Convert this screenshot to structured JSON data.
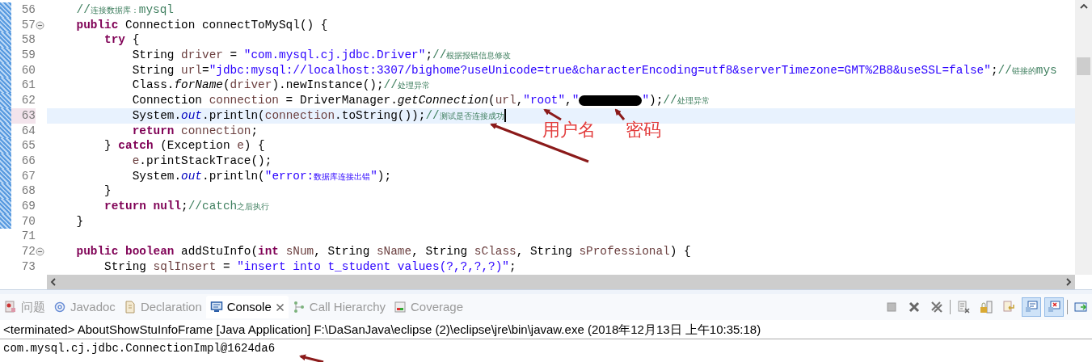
{
  "editor": {
    "lines": [
      {
        "number": "56",
        "fold": false,
        "current": false,
        "changed": true,
        "tokens": [
          {
            "text": "    //",
            "kind": "comment"
          },
          {
            "text": "连接数据库：",
            "kind": "comment_cjk"
          },
          {
            "text": "mysql",
            "kind": "comment"
          }
        ]
      },
      {
        "number": "57",
        "fold": true,
        "current": false,
        "changed": true,
        "tokens": [
          {
            "text": "    public",
            "kind": "kw"
          },
          {
            "text": " Connection connectToMySql() {",
            "kind": "plain"
          }
        ]
      },
      {
        "number": "58",
        "fold": false,
        "current": false,
        "changed": true,
        "tokens": [
          {
            "text": "        try",
            "kind": "kw"
          },
          {
            "text": " {",
            "kind": "plain"
          }
        ]
      },
      {
        "number": "59",
        "fold": false,
        "current": false,
        "changed": true,
        "tokens": [
          {
            "text": "            String ",
            "kind": "plain"
          },
          {
            "text": "driver",
            "kind": "local"
          },
          {
            "text": " = ",
            "kind": "plain"
          },
          {
            "text": "\"com.mysql.cj.jdbc.Driver\"",
            "kind": "str"
          },
          {
            "text": ";",
            "kind": "plain"
          },
          {
            "text": "//",
            "kind": "comment"
          },
          {
            "text": "根据报错信息修改",
            "kind": "comment_cjk"
          }
        ]
      },
      {
        "number": "60",
        "fold": false,
        "current": false,
        "changed": true,
        "tokens": [
          {
            "text": "            String ",
            "kind": "plain"
          },
          {
            "text": "url",
            "kind": "local"
          },
          {
            "text": "=",
            "kind": "plain"
          },
          {
            "text": "\"jdbc:mysql://localhost:3307/bighome?useUnicode=true&characterEncoding=utf8&serverTimezone=GMT%2B8&useSSL=false\"",
            "kind": "str"
          },
          {
            "text": ";",
            "kind": "plain"
          },
          {
            "text": "//",
            "kind": "comment"
          },
          {
            "text": "链接的",
            "kind": "comment_cjk"
          },
          {
            "text": "mys",
            "kind": "comment"
          }
        ]
      },
      {
        "number": "61",
        "fold": false,
        "current": false,
        "changed": true,
        "tokens": [
          {
            "text": "            Class.",
            "kind": "plain"
          },
          {
            "text": "forName",
            "kind": "italic"
          },
          {
            "text": "(",
            "kind": "plain"
          },
          {
            "text": "driver",
            "kind": "local"
          },
          {
            "text": ").newInstance();",
            "kind": "plain"
          },
          {
            "text": "//",
            "kind": "comment"
          },
          {
            "text": "处理异常",
            "kind": "comment_cjk"
          }
        ]
      },
      {
        "number": "62",
        "fold": false,
        "current": false,
        "changed": true,
        "tokens": [
          {
            "text": "            Connection ",
            "kind": "plain"
          },
          {
            "text": "connection",
            "kind": "local"
          },
          {
            "text": " = DriverManager.",
            "kind": "plain"
          },
          {
            "text": "getConnection",
            "kind": "italic"
          },
          {
            "text": "(",
            "kind": "plain"
          },
          {
            "text": "url",
            "kind": "local"
          },
          {
            "text": ",",
            "kind": "plain"
          },
          {
            "text": "\"root\"",
            "kind": "str"
          },
          {
            "text": ",",
            "kind": "plain"
          },
          {
            "text": "\"",
            "kind": "str"
          },
          {
            "kind": "redacted"
          },
          {
            "text": "\"",
            "kind": "str"
          },
          {
            "text": ");",
            "kind": "plain"
          },
          {
            "text": "//",
            "kind": "comment"
          },
          {
            "text": "处理异常",
            "kind": "comment_cjk"
          }
        ]
      },
      {
        "number": "63",
        "fold": false,
        "current": true,
        "changed": true,
        "tokens": [
          {
            "text": "            System.",
            "kind": "plain"
          },
          {
            "text": "out",
            "kind": "static"
          },
          {
            "text": ".println(",
            "kind": "plain"
          },
          {
            "text": "connection",
            "kind": "local"
          },
          {
            "text": ".toString());",
            "kind": "plain"
          },
          {
            "text": "//",
            "kind": "comment"
          },
          {
            "text": "测试是否连接成功",
            "kind": "comment_cjk"
          }
        ]
      },
      {
        "number": "64",
        "fold": false,
        "current": false,
        "changed": true,
        "tokens": [
          {
            "text": "            return",
            "kind": "kw"
          },
          {
            "text": " connection",
            "kind": "local"
          },
          {
            "text": ";",
            "kind": "plain"
          }
        ]
      },
      {
        "number": "65",
        "fold": false,
        "current": false,
        "changed": true,
        "tokens": [
          {
            "text": "        } ",
            "kind": "plain"
          },
          {
            "text": "catch",
            "kind": "kw"
          },
          {
            "text": " (Exception ",
            "kind": "plain"
          },
          {
            "text": "e",
            "kind": "local"
          },
          {
            "text": ") {",
            "kind": "plain"
          }
        ]
      },
      {
        "number": "66",
        "fold": false,
        "current": false,
        "changed": true,
        "tokens": [
          {
            "text": "            e",
            "kind": "local"
          },
          {
            "text": ".printStackTrace();",
            "kind": "plain"
          }
        ]
      },
      {
        "number": "67",
        "fold": false,
        "current": false,
        "changed": true,
        "tokens": [
          {
            "text": "            System.",
            "kind": "plain"
          },
          {
            "text": "out",
            "kind": "static"
          },
          {
            "text": ".println(",
            "kind": "plain"
          },
          {
            "text": "\"error:",
            "kind": "str"
          },
          {
            "text": "数据库连接出错",
            "kind": "str_cjk"
          },
          {
            "text": "\"",
            "kind": "str"
          },
          {
            "text": ");",
            "kind": "plain"
          }
        ]
      },
      {
        "number": "68",
        "fold": false,
        "current": false,
        "changed": true,
        "tokens": [
          {
            "text": "        }",
            "kind": "plain"
          }
        ]
      },
      {
        "number": "69",
        "fold": false,
        "current": false,
        "changed": true,
        "tokens": [
          {
            "text": "        return",
            "kind": "kw"
          },
          {
            "text": " null",
            "kind": "kw"
          },
          {
            "text": ";",
            "kind": "plain"
          },
          {
            "text": "//catch",
            "kind": "comment"
          },
          {
            "text": "之后执行",
            "kind": "comment_cjk"
          }
        ]
      },
      {
        "number": "70",
        "fold": false,
        "current": false,
        "changed": true,
        "tokens": [
          {
            "text": "    }",
            "kind": "plain"
          }
        ]
      },
      {
        "number": "71",
        "fold": false,
        "current": false,
        "changed": false
      },
      {
        "number": "72",
        "fold": true,
        "current": false,
        "changed": false,
        "tokens": [
          {
            "text": "    public",
            "kind": "kw"
          },
          {
            "text": " boolean",
            "kind": "kw"
          },
          {
            "text": " addStuInfo(",
            "kind": "plain"
          },
          {
            "text": "int",
            "kind": "kw"
          },
          {
            "text": " sNum",
            "kind": "local"
          },
          {
            "text": ", String ",
            "kind": "plain"
          },
          {
            "text": "sName",
            "kind": "local"
          },
          {
            "text": ", String ",
            "kind": "plain"
          },
          {
            "text": "sClass",
            "kind": "local"
          },
          {
            "text": ", String ",
            "kind": "plain"
          },
          {
            "text": "sProfessional",
            "kind": "local"
          },
          {
            "text": ") {",
            "kind": "plain"
          }
        ]
      },
      {
        "number": "73",
        "fold": false,
        "current": false,
        "changed": false,
        "tokens": [
          {
            "text": "        String ",
            "kind": "plain"
          },
          {
            "text": "sqlInsert",
            "kind": "local"
          },
          {
            "text": " = ",
            "kind": "plain"
          },
          {
            "text": "\"insert into t_student values(?,?,?,?)\"",
            "kind": "str"
          },
          {
            "text": ";",
            "kind": "plain"
          }
        ]
      }
    ]
  },
  "annotations": [
    {
      "kind": "label",
      "text": "用户名"
    },
    {
      "kind": "label",
      "text": "密码"
    }
  ],
  "panel": {
    "tabs": [
      {
        "label": "问题",
        "kind": "problems",
        "selected": false
      },
      {
        "label": "Javadoc",
        "kind": "javadoc",
        "selected": false
      },
      {
        "label": "Declaration",
        "kind": "declaration",
        "selected": false
      },
      {
        "label": "Console",
        "kind": "console",
        "selected": true
      },
      {
        "label": "Call Hierarchy",
        "kind": "hierarchy",
        "selected": false
      },
      {
        "label": "Coverage",
        "kind": "coverage",
        "selected": false
      }
    ],
    "toolbar": [
      {
        "kind": "stop",
        "selected": false
      },
      {
        "kind": "remove",
        "selected": false
      },
      {
        "kind": "remove-all",
        "selected": false
      },
      {
        "kind": "sep"
      },
      {
        "kind": "clear",
        "selected": false
      },
      {
        "kind": "lock",
        "selected": false
      },
      {
        "kind": "wrap",
        "selected": false
      },
      {
        "kind": "stdout",
        "selected": true
      },
      {
        "kind": "stderr",
        "selected": true
      },
      {
        "kind": "sep"
      },
      {
        "kind": "open",
        "selected": false
      }
    ],
    "console": {
      "header": "<terminated> AboutShowStuInfoFrame [Java Application] F:\\DaSanJava\\eclipse (2)\\eclipse\\jre\\bin\\javaw.exe (2018年12月13日 上午10:35:18)",
      "output": [
        "com.mysql.cj.jdbc.ConnectionImpl@1624da6"
      ]
    }
  }
}
